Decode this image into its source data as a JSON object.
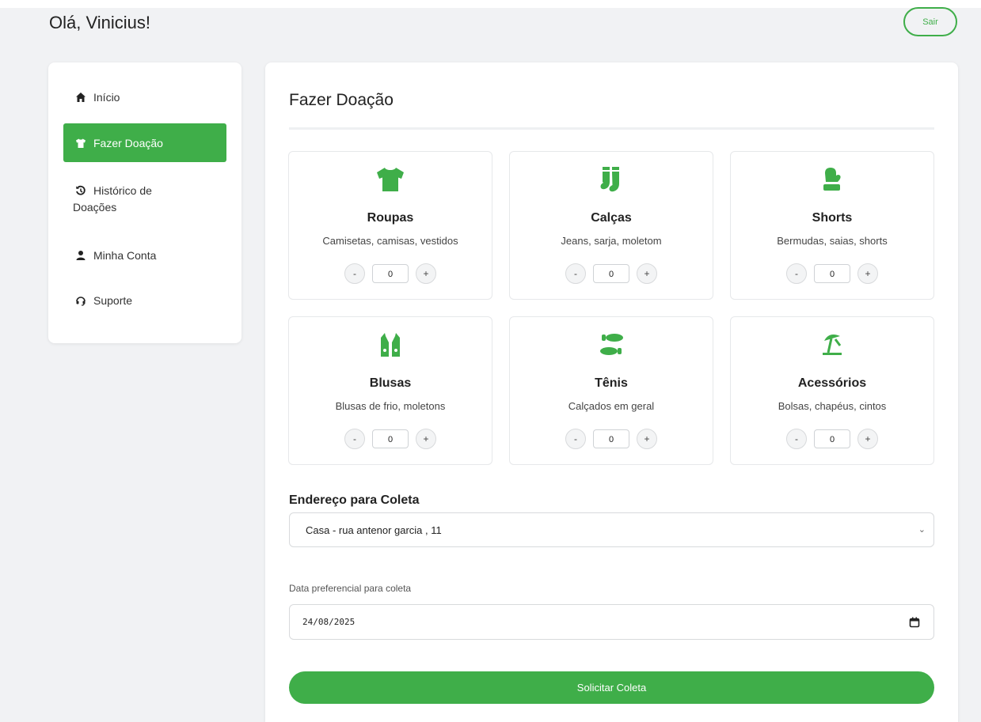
{
  "header": {
    "greeting": "Olá, Vinicius!",
    "logout_label": "Sair"
  },
  "sidebar": {
    "items": [
      {
        "label": "Início",
        "icon": "home-icon"
      },
      {
        "label": "Fazer Doação",
        "icon": "tshirt-icon",
        "active": true
      },
      {
        "label": "Histórico de Doações",
        "icon": "history-icon"
      },
      {
        "label": "Minha Conta",
        "icon": "user-icon"
      },
      {
        "label": "Suporte",
        "icon": "headset-icon"
      }
    ]
  },
  "main": {
    "title": "Fazer Doação",
    "categories": [
      {
        "name": "Roupas",
        "description": "Camisetas, camisas, vestidos",
        "quantity": "0",
        "icon": "tshirt-icon"
      },
      {
        "name": "Calças",
        "description": "Jeans, sarja, moletom",
        "quantity": "0",
        "icon": "socks-icon"
      },
      {
        "name": "Shorts",
        "description": "Bermudas, saias, shorts",
        "quantity": "0",
        "icon": "mitten-icon"
      },
      {
        "name": "Blusas",
        "description": "Blusas de frio, moletons",
        "quantity": "0",
        "icon": "vest-icon"
      },
      {
        "name": "Tênis",
        "description": "Calçados em geral",
        "quantity": "0",
        "icon": "shoe-prints-icon"
      },
      {
        "name": "Acessórios",
        "description": "Bolsas, chapéus, cintos",
        "quantity": "0",
        "icon": "umbrella-beach-icon"
      }
    ],
    "stepper": {
      "minus": "-",
      "plus": "+"
    },
    "address": {
      "label": "Endereço para Coleta",
      "selected": "Casa - rua antenor garcia , 11"
    },
    "date": {
      "label": "Data preferencial para coleta",
      "value": "24/08/2025"
    },
    "submit_label": "Solicitar Coleta"
  },
  "colors": {
    "accent": "#3fae49",
    "background": "#f1f2f4"
  }
}
